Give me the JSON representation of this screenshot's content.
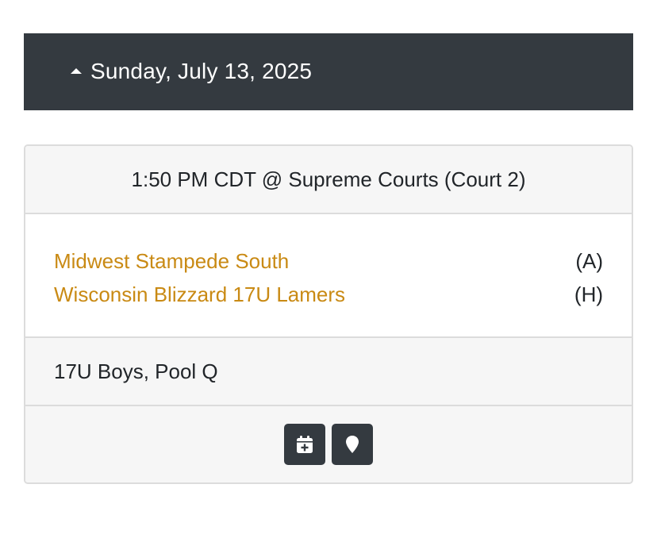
{
  "date_header": {
    "label": "Sunday, July 13, 2025",
    "toggle_icon": "caret-up-icon"
  },
  "game": {
    "time_location": "1:50 PM CDT @ Supreme Courts (Court 2)",
    "teams": [
      {
        "name": "Midwest Stampede South",
        "role": "(A)"
      },
      {
        "name": "Wisconsin Blizzard 17U Lamers",
        "role": "(H)"
      }
    ],
    "division": "17U Boys, Pool Q",
    "actions": [
      {
        "icon": "calendar-plus-icon"
      },
      {
        "icon": "map-marker-icon"
      }
    ]
  },
  "colors": {
    "header_bg": "#343a40",
    "team_link": "#c98a14",
    "card_bg": "#f6f6f6",
    "border": "#dcdcdc"
  }
}
